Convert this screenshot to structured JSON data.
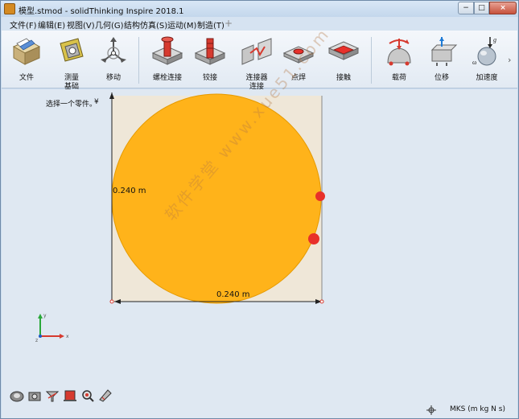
{
  "window": {
    "title": "模型.stmod - solidThinking Inspire 2018.1",
    "min_label": "−",
    "max_label": "□",
    "close_label": "×"
  },
  "menu": {
    "items": [
      {
        "label": "文件(F)",
        "active": false
      },
      {
        "label": "编辑(E)",
        "active": false
      },
      {
        "label": "视图(V)",
        "active": false
      },
      {
        "label": "几何(G)",
        "active": false
      },
      {
        "label": "结构仿真(S)",
        "active": true
      },
      {
        "label": "运动(M)",
        "active": false
      },
      {
        "label": "制造(T)",
        "active": false
      }
    ],
    "add_label": "+"
  },
  "toolbar": {
    "tools": [
      {
        "label": "文件",
        "icon": "file-open-icon"
      },
      {
        "label": "测量\n基础",
        "icon": "measure-icon"
      },
      {
        "label": "移动",
        "icon": "move-icon"
      },
      {
        "label": "螺栓连接",
        "icon": "bolt-connection-icon"
      },
      {
        "label": "铰接",
        "icon": "hinge-icon"
      },
      {
        "label": "连接器\n连接",
        "icon": "connector-icon"
      },
      {
        "label": "点焊",
        "icon": "spot-weld-icon"
      },
      {
        "label": "接触",
        "icon": "contact-icon"
      },
      {
        "label": "载荷",
        "icon": "load-icon"
      },
      {
        "label": "位移",
        "icon": "displacement-icon"
      },
      {
        "label": "加速度",
        "icon": "acceleration-icon"
      }
    ],
    "more_label": "›"
  },
  "canvas": {
    "select_hint": "选择一个零件。",
    "select_chevron": "¥",
    "dimension_width": "0.240 m",
    "dimension_height": "0.240 m",
    "watermark": "软件学堂 www.xue51.com",
    "colors": {
      "part_fill": "#ffb31a",
      "part_stroke": "#e69a00",
      "background_square": "#efe7d8",
      "load_marker": "#e8302a",
      "dimension_line": "#222222"
    }
  },
  "axes": {
    "x_label": "x",
    "y_label": "y",
    "z_label": "z"
  },
  "status": {
    "units": "MKS (m kg N s)"
  }
}
